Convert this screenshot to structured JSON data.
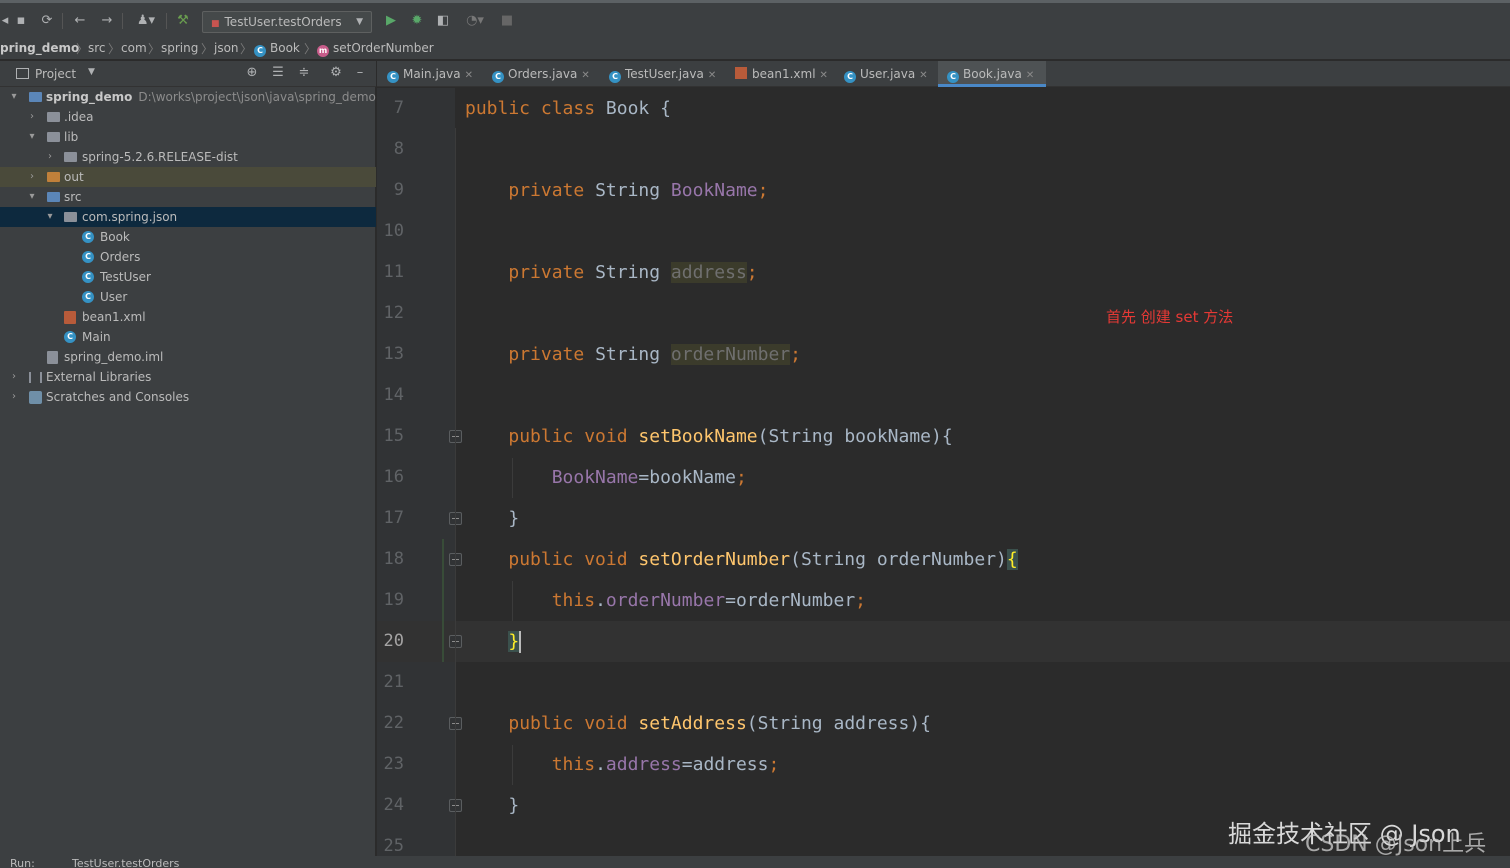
{
  "toolbar": {
    "run_config": "TestUser.testOrders",
    "icons": [
      "save-icon",
      "sync-icon",
      "back-icon",
      "forward-icon",
      "user-icon",
      "build-icon",
      "run-icon",
      "debug-icon",
      "coverage-icon",
      "profile-icon",
      "stop-icon"
    ]
  },
  "breadcrumb": {
    "items": [
      "pring_demo",
      "src",
      "com",
      "spring",
      "json",
      "Book",
      "setOrderNumber"
    ]
  },
  "project_panel": {
    "title": "Project",
    "tree": [
      {
        "label": "spring_demo",
        "path": "D:\\works\\project\\json\\java\\spring_demo"
      },
      {
        "label": ".idea"
      },
      {
        "label": "lib"
      },
      {
        "label": "spring-5.2.6.RELEASE-dist"
      },
      {
        "label": "out"
      },
      {
        "label": "src"
      },
      {
        "label": "com.spring.json"
      },
      {
        "label": "Book"
      },
      {
        "label": "Orders"
      },
      {
        "label": "TestUser"
      },
      {
        "label": "User"
      },
      {
        "label": "bean1.xml"
      },
      {
        "label": "Main"
      },
      {
        "label": "spring_demo.iml"
      },
      {
        "label": "External Libraries"
      },
      {
        "label": "Scratches and Consoles"
      }
    ]
  },
  "editor": {
    "tabs": [
      "Main.java",
      "Orders.java",
      "TestUser.java",
      "bean1.xml",
      "User.java",
      "Book.java"
    ],
    "active_tab": "Book.java",
    "line_numbers": [
      "7",
      "8",
      "9",
      "10",
      "11",
      "12",
      "13",
      "14",
      "15",
      "16",
      "17",
      "18",
      "19",
      "20",
      "21",
      "22",
      "23",
      "24",
      "25"
    ],
    "current_line": "20",
    "code": {
      "l7_kw": "public class ",
      "l7_rest": "Book {",
      "l9_kw": "private ",
      "l9_type": "String ",
      "l9_field": "BookName",
      "l9_semi": ";",
      "l11_kw": "private ",
      "l11_type": "String ",
      "l11_field": "address",
      "l11_semi": ";",
      "l13_kw": "private ",
      "l13_type": "String ",
      "l13_field": "orderNumber",
      "l13_semi": ";",
      "l15_kw": "public void ",
      "l15_method": "setBookName",
      "l15_rest": "(String bookName){",
      "l16_field": "BookName",
      "l16_rest": "=bookName",
      "l16_semi": ";",
      "l17": "}",
      "l18_kw": "public void ",
      "l18_method": "setOrderNumber",
      "l18_rest": "(String orderNumber)",
      "l18_brace": "{",
      "l19_kw": "this",
      "l19_dot": ".",
      "l19_field": "orderNumber",
      "l19_rest": "=orderNumber",
      "l19_semi": ";",
      "l20_brace": "}",
      "l22_kw": "public void ",
      "l22_method": "setAddress",
      "l22_rest": "(String address){",
      "l23_kw": "this",
      "l23_dot": ".",
      "l23_field": "address",
      "l23_rest": "=address",
      "l23_semi": ";",
      "l24": "}"
    }
  },
  "annotation": "首先 创建 set 方法",
  "watermark": "掘金技术社区 @ Json",
  "watermark2": "CSDN @Json上兵",
  "bottom_strip": {
    "run_label": "Run:",
    "run_config": "TestUser.testOrders"
  },
  "colors": {
    "keyword": "#cc7832",
    "field": "#9876aa",
    "method": "#ffc66d",
    "text": "#a9b7c6",
    "annotation": "#e53935",
    "selection": "#0d293e",
    "tab_underline": "#4a88c7"
  }
}
